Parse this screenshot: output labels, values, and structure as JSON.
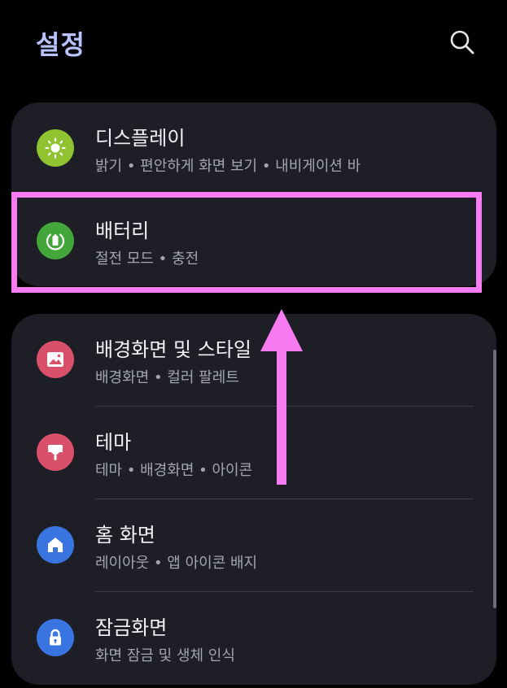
{
  "header": {
    "title": "설정",
    "search_icon": "search-icon"
  },
  "colors": {
    "background": "#000000",
    "card": "#1d1e26",
    "title": "#b9c3ff",
    "highlight": "#f77cf2",
    "display_icon": "#8fc32f",
    "battery_icon": "#43a63a",
    "wallpaper_icon": "#d9506a",
    "theme_icon": "#d9506a",
    "home_icon": "#3a74e0",
    "lock_icon": "#3a74e0"
  },
  "groups": [
    {
      "items": [
        {
          "title": "디스플레이",
          "subtitle": "밝기  •  편안하게 화면 보기  •  내비게이션 바",
          "icon": "sun-icon"
        },
        {
          "title": "배터리",
          "subtitle": "절전 모드  •  충전",
          "icon": "battery-icon"
        }
      ]
    },
    {
      "items": [
        {
          "title": "배경화면 및 스타일",
          "subtitle": "배경화면  •  컬러 팔레트",
          "icon": "image-icon"
        },
        {
          "title": "테마",
          "subtitle": "테마  •  배경화면  •  아이콘",
          "icon": "paintbrush-icon"
        },
        {
          "title": "홈 화면",
          "subtitle": "레이아웃  •  앱 아이콘 배지",
          "icon": "home-icon"
        },
        {
          "title": "잠금화면",
          "subtitle": "화면 잠금 및 생체 인식",
          "icon": "lock-icon"
        }
      ]
    }
  ]
}
